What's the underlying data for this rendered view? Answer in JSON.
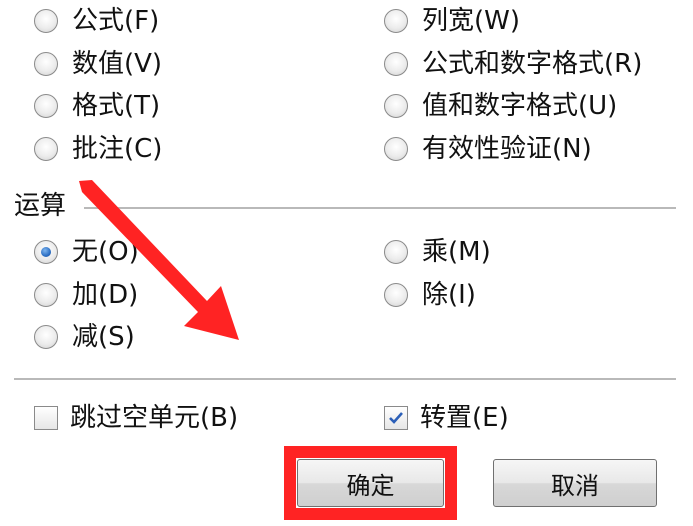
{
  "paste_options": [
    {
      "label": "公式(F)",
      "checked": false
    },
    {
      "label": "列宽(W)",
      "checked": false
    },
    {
      "label": "数值(V)",
      "checked": false
    },
    {
      "label": "公式和数字格式(R)",
      "checked": false
    },
    {
      "label": "格式(T)",
      "checked": false
    },
    {
      "label": "值和数字格式(U)",
      "checked": false
    },
    {
      "label": "批注(C)",
      "checked": false
    },
    {
      "label": "有效性验证(N)",
      "checked": false
    }
  ],
  "operation": {
    "title": "运算",
    "options": [
      {
        "label": "无(O)",
        "checked": true
      },
      {
        "label": "乘(M)",
        "checked": false
      },
      {
        "label": "加(D)",
        "checked": false
      },
      {
        "label": "除(I)",
        "checked": false
      },
      {
        "label": "减(S)",
        "checked": false
      }
    ]
  },
  "checkboxes": {
    "skip_blanks": {
      "label": "跳过空单元(B)",
      "checked": false
    },
    "transpose": {
      "label": "转置(E)",
      "checked": true
    }
  },
  "buttons": {
    "ok": "确定",
    "cancel": "取消"
  },
  "annotation_color": "#ff2323"
}
